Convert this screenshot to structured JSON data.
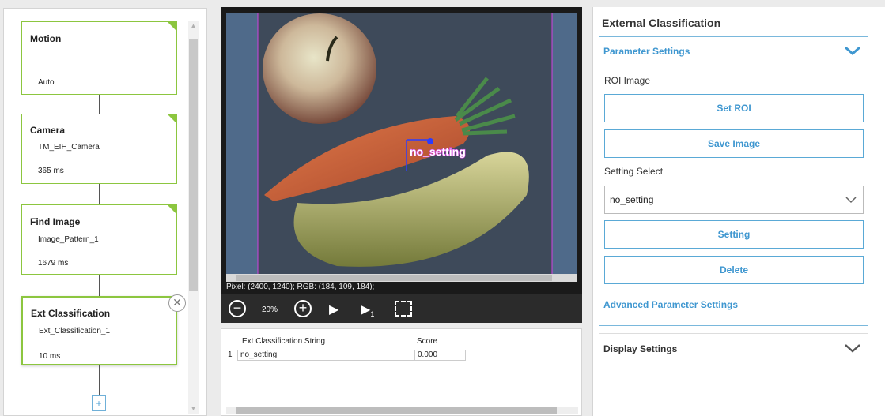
{
  "flow": {
    "nodes": [
      {
        "title": "Motion",
        "line1": "",
        "line2": "Auto"
      },
      {
        "title": "Camera",
        "line1": "TM_EIH_Camera",
        "line2": "365 ms"
      },
      {
        "title": "Find Image",
        "line1": "Image_Pattern_1",
        "line2": "1679 ms"
      },
      {
        "title": "Ext Classification",
        "line1": "Ext_Classification_1",
        "line2": "10 ms"
      }
    ]
  },
  "viewer": {
    "overlay_label": "no_setting",
    "status": "Pixel: (2400, 1240); RGB: (184, 109, 184);",
    "zoom": "20%"
  },
  "results": {
    "columns": [
      "Ext Classification String",
      "Score"
    ],
    "rows": [
      {
        "index": "1",
        "string": "no_setting",
        "score": "0.000"
      }
    ]
  },
  "settings": {
    "title": "External Classification",
    "parameter_settings": "Parameter Settings",
    "roi_image_label": "ROI Image",
    "set_roi": "Set ROI",
    "save_image": "Save Image",
    "setting_select_label": "Setting Select",
    "setting_select_value": "no_setting",
    "setting_button": "Setting",
    "delete_button": "Delete",
    "advanced": "Advanced Parameter Settings",
    "display_settings": "Display Settings"
  },
  "colors": {
    "flow_green": "#8cc63f",
    "accent_blue": "#3f97d0",
    "overlay_magenta": "#e040fb"
  }
}
